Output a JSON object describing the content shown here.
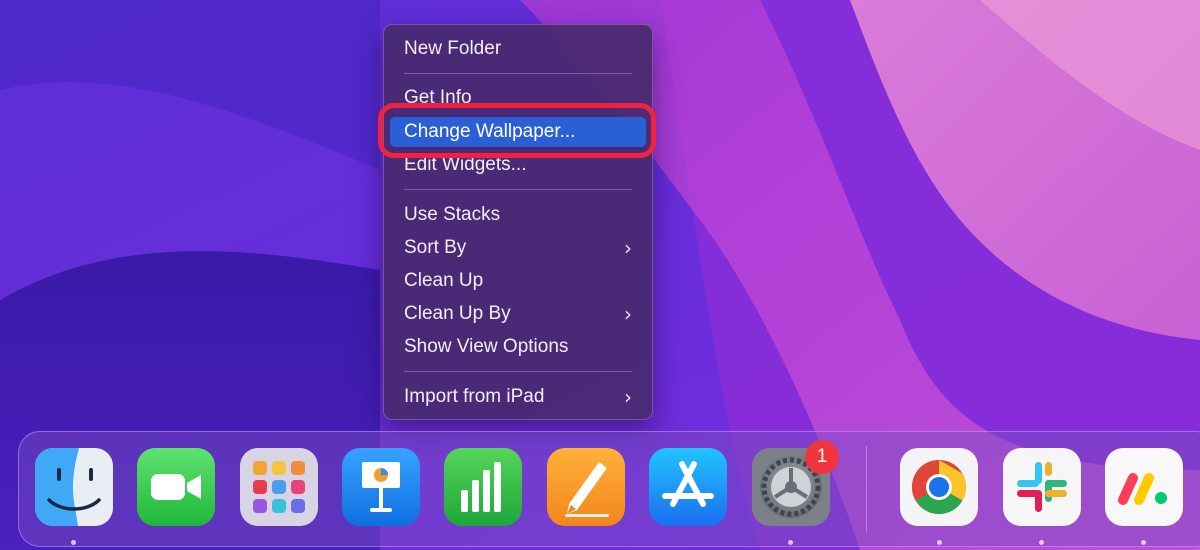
{
  "menu": {
    "items": [
      {
        "label": "New Folder",
        "has_submenu": false
      },
      {
        "label": "Get Info",
        "has_submenu": false
      },
      {
        "label": "Change Wallpaper...",
        "has_submenu": false,
        "selected": true
      },
      {
        "label": "Edit Widgets...",
        "has_submenu": false
      },
      {
        "label": "Use Stacks",
        "has_submenu": false
      },
      {
        "label": "Sort By",
        "has_submenu": true
      },
      {
        "label": "Clean Up",
        "has_submenu": false
      },
      {
        "label": "Clean Up By",
        "has_submenu": true
      },
      {
        "label": "Show View Options",
        "has_submenu": false
      },
      {
        "label": "Import from iPad",
        "has_submenu": true
      }
    ],
    "submenu_glyph": "›",
    "highlight_color": "#f0223e",
    "selected_color": "#2a5fd6"
  },
  "dock": {
    "apps": [
      {
        "name": "finder-icon",
        "running": true
      },
      {
        "name": "facetime-icon",
        "running": false
      },
      {
        "name": "launchpad-icon",
        "running": false
      },
      {
        "name": "keynote-icon",
        "running": false
      },
      {
        "name": "numbers-icon",
        "running": false
      },
      {
        "name": "pages-icon",
        "running": false
      },
      {
        "name": "app-store-icon",
        "running": false
      },
      {
        "name": "system-preferences-icon",
        "running": true,
        "badge": "1"
      },
      {
        "name": "chrome-icon",
        "running": true
      },
      {
        "name": "slack-icon",
        "running": true
      },
      {
        "name": "monday-icon",
        "running": true
      }
    ]
  }
}
